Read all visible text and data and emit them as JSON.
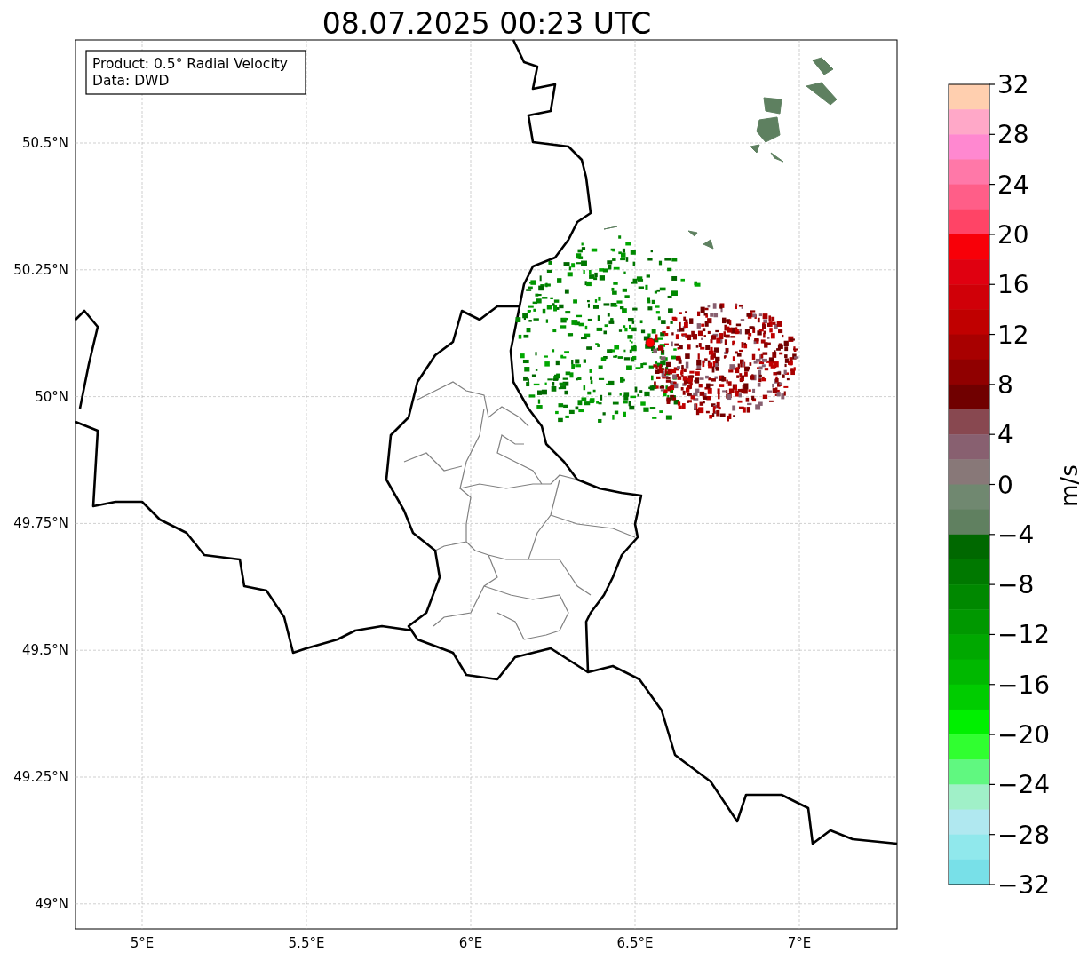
{
  "title": "08.07.2025 00:23 UTC",
  "map": {
    "legend": [
      "Product: 0.5° Radial Velocity",
      "Data: DWD"
    ],
    "y_ticks": [
      "50.5°N",
      "50.25°N",
      "50°N",
      "49.75°N",
      "49.5°N",
      "49.25°N",
      "49°N"
    ],
    "x_ticks": [
      "5°E",
      "5.5°E",
      "6°E",
      "6.5°E",
      "7°E"
    ]
  },
  "colorbar": {
    "label": "m/s",
    "ticks": [
      "32",
      "28",
      "24",
      "20",
      "16",
      "12",
      "8",
      "4",
      "0",
      "−4",
      "−8",
      "−12",
      "−16",
      "−20",
      "−24",
      "−28",
      "−32"
    ],
    "segments": [
      {
        "color": "#ffcfaf"
      },
      {
        "color": "#ffa8c8"
      },
      {
        "color": "#ff88d0"
      },
      {
        "color": "#ff78a8"
      },
      {
        "color": "#ff5e88"
      },
      {
        "color": "#ff4466"
      },
      {
        "color": "#f80008"
      },
      {
        "color": "#e00010"
      },
      {
        "color": "#d00008"
      },
      {
        "color": "#c00000"
      },
      {
        "color": "#a80000"
      },
      {
        "color": "#900000"
      },
      {
        "color": "#700000"
      },
      {
        "color": "#884850"
      },
      {
        "color": "#886070"
      },
      {
        "color": "#887878"
      },
      {
        "color": "#708870"
      },
      {
        "color": "#608060"
      },
      {
        "color": "#006800"
      },
      {
        "color": "#007800"
      },
      {
        "color": "#008800"
      },
      {
        "color": "#009800"
      },
      {
        "color": "#00a800"
      },
      {
        "color": "#00b800"
      },
      {
        "color": "#00cc00"
      },
      {
        "color": "#00f000"
      },
      {
        "color": "#30ff30"
      },
      {
        "color": "#60f880"
      },
      {
        "color": "#a0f0c8"
      },
      {
        "color": "#b0e8f0"
      },
      {
        "color": "#90e8ec"
      },
      {
        "color": "#78e0e8"
      }
    ]
  }
}
